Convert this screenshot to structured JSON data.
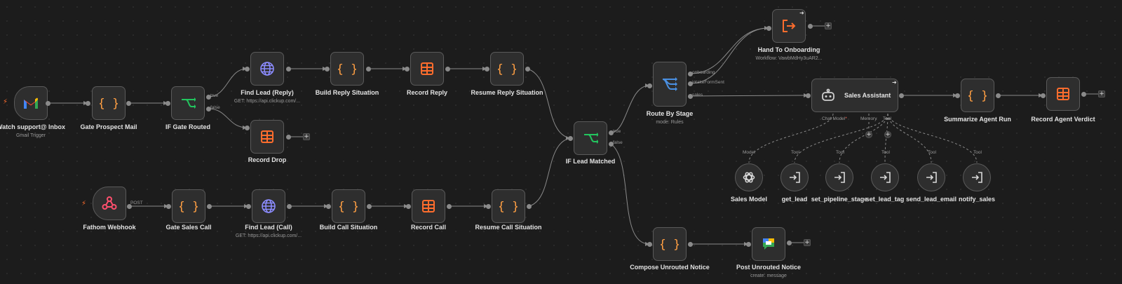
{
  "nodes": {
    "watch_inbox": {
      "title": "Watch support@ Inbox",
      "subtitle": "Gmail Trigger"
    },
    "gate_prospect_mail": {
      "title": "Gate Prospect Mail"
    },
    "if_gate_routed": {
      "title": "IF Gate Routed",
      "true_label": "true",
      "false_label": "false"
    },
    "find_lead_reply": {
      "title": "Find Lead (Reply)",
      "subtitle": "GET: https://api.clickup.com/..."
    },
    "build_reply_situation": {
      "title": "Build Reply Situation"
    },
    "record_reply": {
      "title": "Record Reply"
    },
    "resume_reply_situation": {
      "title": "Resume Reply Situation"
    },
    "record_drop": {
      "title": "Record Drop"
    },
    "fathom_webhook": {
      "title": "Fathom Webhook",
      "port_label": "POST"
    },
    "gate_sales_call": {
      "title": "Gate Sales Call"
    },
    "find_lead_call": {
      "title": "Find Lead (Call)",
      "subtitle": "GET: https://api.clickup.com/..."
    },
    "build_call_situation": {
      "title": "Build Call Situation"
    },
    "record_call": {
      "title": "Record Call"
    },
    "resume_call_situation": {
      "title": "Resume Call Situation"
    },
    "if_lead_matched": {
      "title": "IF Lead Matched",
      "true_label": "true",
      "false_label": "false"
    },
    "route_by_stage": {
      "title": "Route By Stage",
      "subtitle": "mode: Rules",
      "outputs": [
        "onboarding",
        "intakeFormSent",
        "sales"
      ]
    },
    "hand_to_onboarding": {
      "title": "Hand To Onboarding",
      "subtitle": "Workflow: VawbMdHy3uAR2..."
    },
    "sales_assistant": {
      "title": "Sales Assistant",
      "inputs": {
        "chat_model": "Chat Model",
        "required_mark": "*",
        "memory": "Memory",
        "tool": "Tool"
      }
    },
    "summarize_agent_run": {
      "title": "Summarize Agent Run"
    },
    "record_agent_verdict": {
      "title": "Record Agent Verdict"
    },
    "compose_unrouted_notice": {
      "title": "Compose Unrouted Notice"
    },
    "post_unrouted_notice": {
      "title": "Post Unrouted Notice",
      "subtitle": "create: message"
    }
  },
  "sub_nodes": [
    {
      "port_label": "Model",
      "title": "Sales Model",
      "icon": "openai-icon"
    },
    {
      "port_label": "Tool",
      "title": "get_lead",
      "icon": "tool-arrow-icon"
    },
    {
      "port_label": "Tool",
      "title": "set_pipeline_stage",
      "icon": "tool-arrow-icon"
    },
    {
      "port_label": "Tool",
      "title": "set_lead_tag",
      "icon": "tool-arrow-icon"
    },
    {
      "port_label": "Tool",
      "title": "send_lead_email",
      "icon": "tool-arrow-icon"
    },
    {
      "port_label": "Tool",
      "title": "notify_sales",
      "icon": "tool-arrow-icon"
    }
  ],
  "colors": {
    "canvas": "#1c1c1c",
    "node": "#2e2e2e",
    "edge": "#8a8a8a",
    "code": "#ff9f43",
    "table": "#ff6d2d",
    "http": "#8c8cff",
    "if": "#22c55e",
    "switch": "#4a90e2",
    "webhook": "#ff4f6d",
    "trigger_bolt": "#ff6d2d"
  },
  "plus_symbol": "+"
}
